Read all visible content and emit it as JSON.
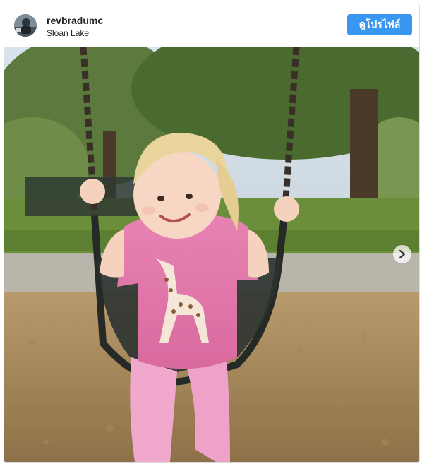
{
  "post": {
    "username": "revbradumc",
    "location": "Sloan Lake",
    "profile_button_label": "ดูโปรไฟล์"
  },
  "icons": {
    "next": "chevron-right-icon"
  }
}
